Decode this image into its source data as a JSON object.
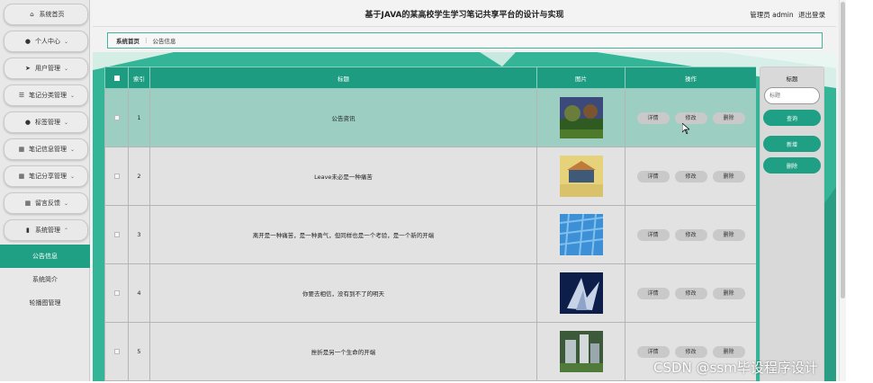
{
  "header": {
    "title": "基于JAVA的某高校学生学习笔记共享平台的设计与实现",
    "admin_label": "管理员 admin",
    "logout_label": "退出登录"
  },
  "sidebar": {
    "items": [
      {
        "label": "系统首页",
        "icon": "home-icon"
      },
      {
        "label": "个人中心",
        "icon": "user-icon"
      },
      {
        "label": "用户管理",
        "icon": "send-icon"
      },
      {
        "label": "笔记分类管理",
        "icon": "list-icon"
      },
      {
        "label": "标签管理",
        "icon": "user-icon"
      },
      {
        "label": "笔记信息管理",
        "icon": "grid-icon"
      },
      {
        "label": "笔记分享管理",
        "icon": "grid-icon"
      },
      {
        "label": "留言反馈",
        "icon": "grid-icon"
      },
      {
        "label": "系统管理",
        "icon": "file-icon"
      }
    ],
    "sub_items": [
      {
        "label": "公告信息"
      },
      {
        "label": "系统简介"
      },
      {
        "label": "轮播图管理"
      }
    ]
  },
  "breadcrumb": {
    "home": "系统首页",
    "separator": "⋮",
    "current": "公告信息"
  },
  "table": {
    "columns": [
      "索引",
      "标题",
      "图片",
      "操作"
    ],
    "rows": [
      {
        "index": "1",
        "title": "公告资讯"
      },
      {
        "index": "2",
        "title": "Leave未必是一种痛苦"
      },
      {
        "index": "3",
        "title": "离开是一种痛苦，是一种勇气，但同样也是一个考验，是一个新的开端"
      },
      {
        "index": "4",
        "title": "你要去相信，没有到不了的明天"
      },
      {
        "index": "5",
        "title": "挫折是另一个生命的开端"
      }
    ],
    "actions": {
      "detail": "详情",
      "edit": "修改",
      "delete": "删除"
    }
  },
  "panel": {
    "title": "标题",
    "search_placeholder": "标题",
    "query_label": "查询",
    "add_label": "新增",
    "delete_label": "删除"
  },
  "watermark": "CSDN @ssm毕设程序设计",
  "colors": {
    "accent": "#1fa085",
    "background_teal": "#35b597",
    "highlight_row": "#9ccfc2"
  }
}
